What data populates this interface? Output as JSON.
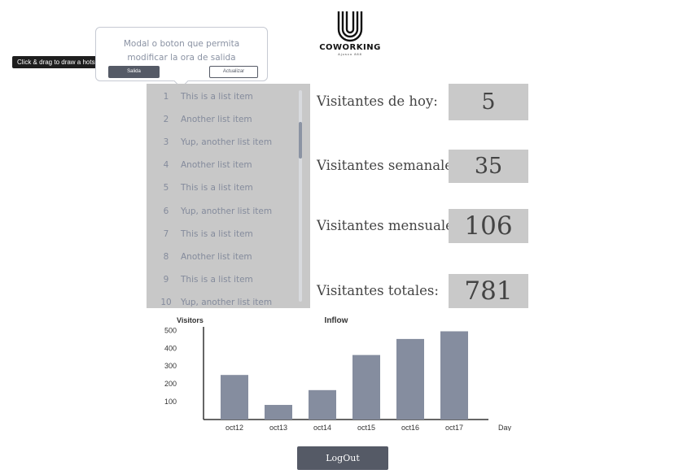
{
  "logo": {
    "brand": "COWORKING",
    "sub": "Ajusco 888"
  },
  "hotspot_hint": "Click & drag to draw a hotspot",
  "modal": {
    "message": "Modal o boton que permita modificar la ora de salida",
    "salida_label": "Salida",
    "actualizar_label": "Actualizar"
  },
  "visitor_list": {
    "items": [
      {
        "num": "1",
        "text": "This is a list item"
      },
      {
        "num": "2",
        "text": "Another list item"
      },
      {
        "num": "3",
        "text": "Yup, another list item"
      },
      {
        "num": "4",
        "text": "Another list item"
      },
      {
        "num": "5",
        "text": "This is a list item"
      },
      {
        "num": "6",
        "text": "Yup, another list item"
      },
      {
        "num": "7",
        "text": "This is a list item"
      },
      {
        "num": "8",
        "text": "Another list item"
      },
      {
        "num": "9",
        "text": "This is a list item"
      },
      {
        "num": "10",
        "text": "Yup, another list item"
      }
    ]
  },
  "stats": {
    "today": {
      "label": "Visitantes de hoy:",
      "value": "5"
    },
    "weekly": {
      "label": "Visitantes semanales:",
      "value": "35"
    },
    "monthly": {
      "label": "Visitantes mensuales:",
      "value": "106"
    },
    "total": {
      "label": "Visitantes totales:",
      "value": "781"
    }
  },
  "chart_data": {
    "type": "bar",
    "title": "Inflow",
    "ylabel": "Visitors",
    "xlabel": "Day",
    "categories": [
      "oct12",
      "oct13",
      "oct14",
      "oct15",
      "oct16",
      "oct17"
    ],
    "values": [
      250,
      82,
      165,
      362,
      452,
      495
    ],
    "yticks": [
      100,
      200,
      300,
      400,
      500
    ],
    "ylim": [
      0,
      520
    ],
    "grid": false,
    "bar_color": "#858d9f"
  },
  "logout_label": "LogOut"
}
